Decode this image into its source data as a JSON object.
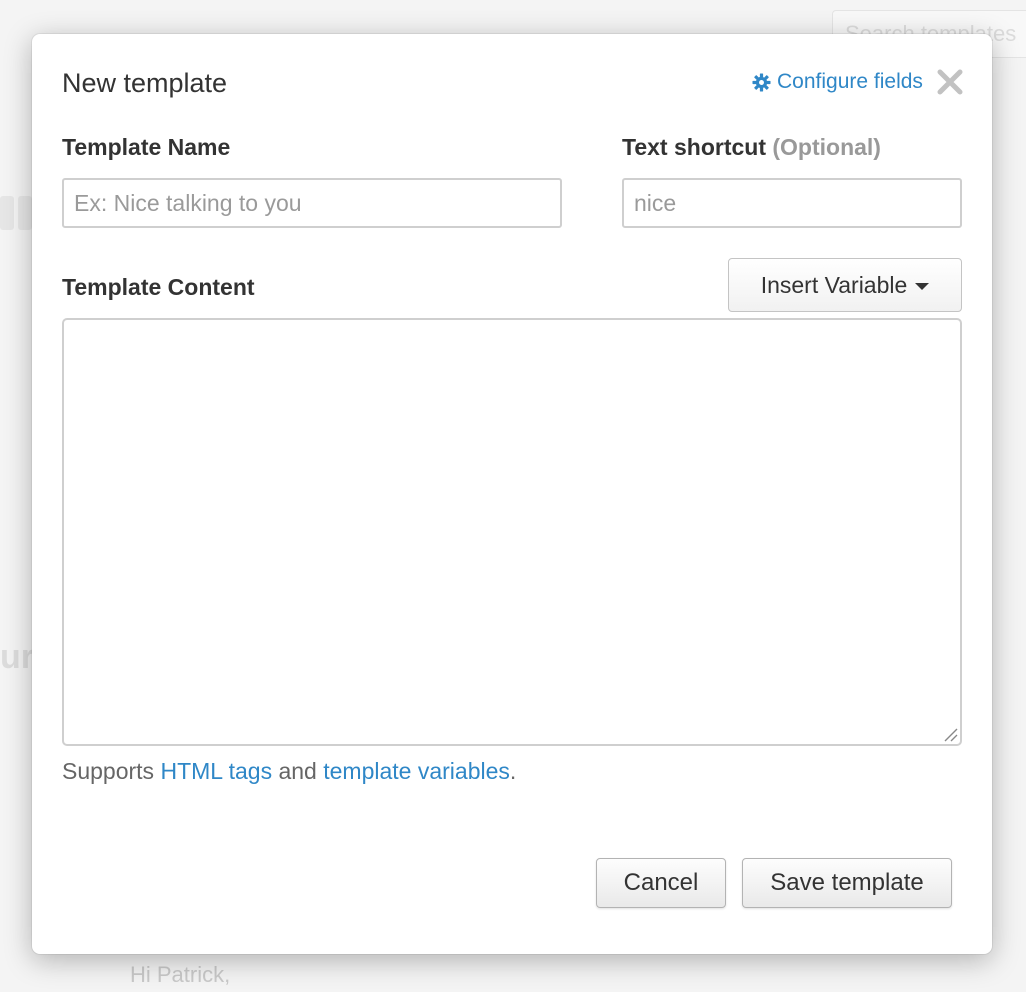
{
  "background": {
    "search_placeholder": "Search templates",
    "fragment_text": "ur",
    "greeting": "Hi Patrick,"
  },
  "modal": {
    "title": "New template",
    "configure_fields_label": "Configure fields",
    "close_icon": "close-icon",
    "template_name": {
      "label": "Template Name",
      "placeholder": "Ex: Nice talking to you",
      "value": ""
    },
    "text_shortcut": {
      "label": "Text shortcut",
      "optional_label": "(Optional)",
      "placeholder": "nice",
      "value": ""
    },
    "template_content": {
      "label": "Template Content",
      "value": ""
    },
    "insert_variable_label": "Insert Variable",
    "supports": {
      "prefix": "Supports",
      "html_tags_link": "HTML tags",
      "conjunction": "and",
      "template_variables_link": "template variables",
      "suffix": "."
    },
    "cancel_label": "Cancel",
    "save_label": "Save template"
  },
  "colors": {
    "link": "#2f87c7",
    "text": "#333333",
    "muted": "#999999"
  }
}
